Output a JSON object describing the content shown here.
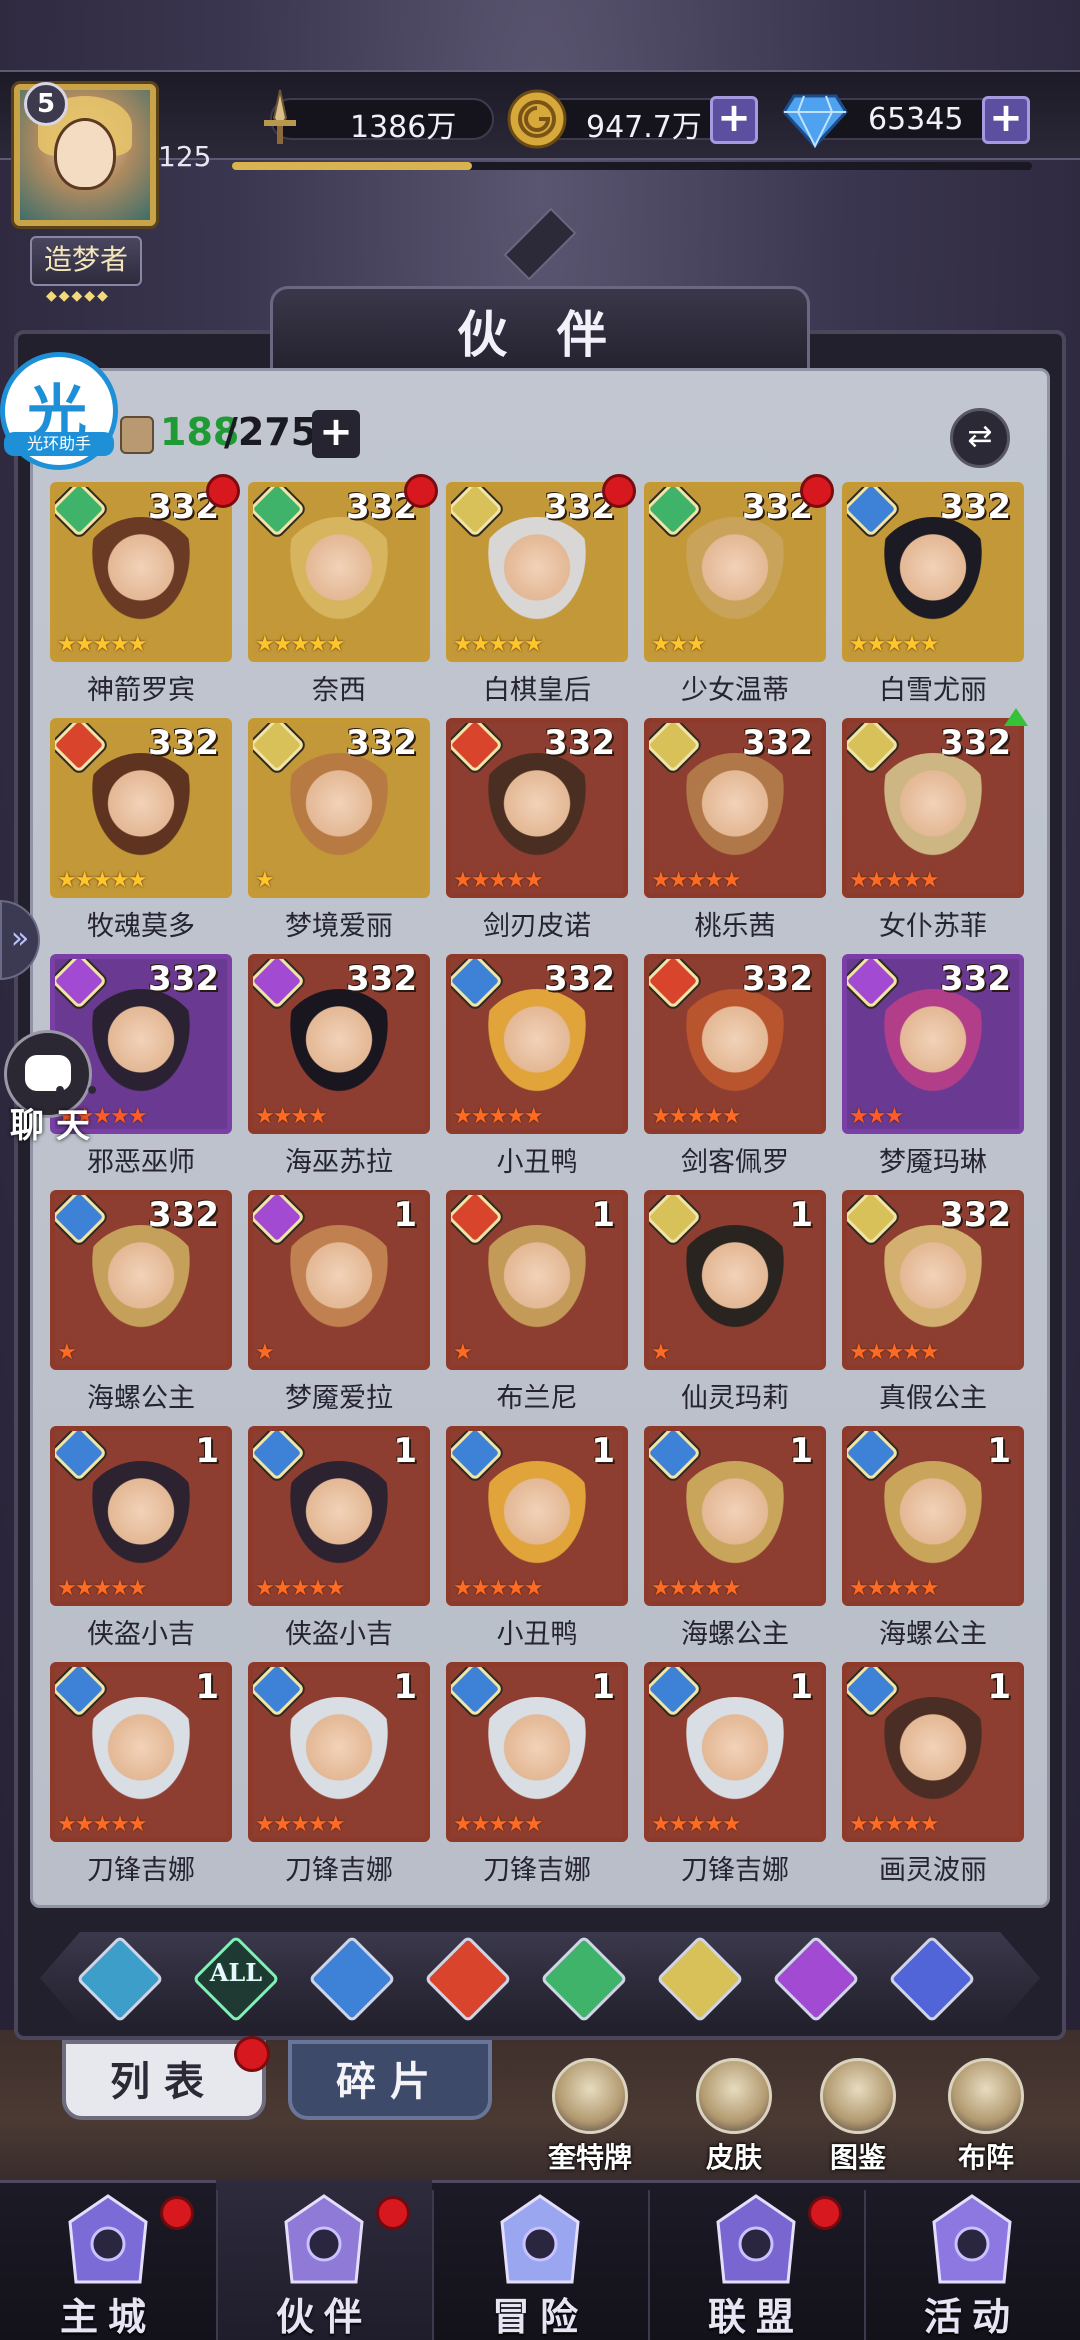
{
  "player": {
    "level": "5",
    "exp_value": "125",
    "title_badge": "造梦者",
    "exp_progress": 0.3
  },
  "resources": {
    "power": "1386万",
    "gold": "947.7万",
    "diamond": "65345"
  },
  "panel": {
    "title": "伙 伴"
  },
  "assistant": {
    "char": "光",
    "label": "光环助手"
  },
  "chat": {
    "label": "聊 天"
  },
  "roster": {
    "current": "188",
    "max": "/275"
  },
  "heroes": [
    {
      "name": "神箭罗宾",
      "level": "332",
      "element": "earth",
      "rarity": "gold",
      "stars": "★★★★★",
      "red_dot": true
    },
    {
      "name": "奈西",
      "level": "332",
      "element": "earth",
      "rarity": "gold",
      "stars": "★★★★★",
      "red_dot": true
    },
    {
      "name": "白棋皇后",
      "level": "332",
      "element": "light",
      "rarity": "gold",
      "stars": "★★★★★",
      "red_dot": true
    },
    {
      "name": "少女温蒂",
      "level": "332",
      "element": "earth",
      "rarity": "gold",
      "stars": "★★★",
      "red_dot": true
    },
    {
      "name": "白雪尤丽",
      "level": "332",
      "element": "water",
      "rarity": "gold",
      "stars": "★★★★★",
      "red_dot": false
    },
    {
      "name": "牧魂莫多",
      "level": "332",
      "element": "fire",
      "rarity": "gold",
      "stars": "★★★★★",
      "red_dot": false
    },
    {
      "name": "梦境爱丽",
      "level": "332",
      "element": "light",
      "rarity": "gold",
      "stars": "★",
      "red_dot": false
    },
    {
      "name": "剑刃皮诺",
      "level": "332",
      "element": "fire",
      "rarity": "red",
      "stars": "★★★★★",
      "red_dot": false
    },
    {
      "name": "桃乐茜",
      "level": "332",
      "element": "light",
      "rarity": "red",
      "stars": "★★★★★",
      "red_dot": false
    },
    {
      "name": "女仆苏菲",
      "level": "332",
      "element": "light",
      "rarity": "red",
      "stars": "★★★★★",
      "red_dot": false,
      "up": true
    },
    {
      "name": "邪恶巫师",
      "level": "332",
      "element": "dark",
      "rarity": "purple",
      "stars": "★★★★★",
      "red_dot": false
    },
    {
      "name": "海巫苏拉",
      "level": "332",
      "element": "dark",
      "rarity": "red",
      "stars": "★★★★",
      "red_dot": false
    },
    {
      "name": "小丑鸭",
      "level": "332",
      "element": "water",
      "rarity": "red",
      "stars": "★★★★★",
      "red_dot": false
    },
    {
      "name": "剑客佩罗",
      "level": "332",
      "element": "fire",
      "rarity": "red",
      "stars": "★★★★★",
      "red_dot": false
    },
    {
      "name": "梦魇玛琳",
      "level": "332",
      "element": "dark",
      "rarity": "purple",
      "stars": "★★★",
      "red_dot": false
    },
    {
      "name": "海螺公主",
      "level": "332",
      "element": "water",
      "rarity": "red",
      "stars": "★",
      "red_dot": false
    },
    {
      "name": "梦魇爱拉",
      "level": "1",
      "element": "dark",
      "rarity": "red",
      "stars": "★",
      "red_dot": false
    },
    {
      "name": "布兰尼",
      "level": "1",
      "element": "fire",
      "rarity": "red",
      "stars": "★",
      "red_dot": false
    },
    {
      "name": "仙灵玛莉",
      "level": "1",
      "element": "light",
      "rarity": "red",
      "stars": "★",
      "red_dot": false
    },
    {
      "name": "真假公主",
      "level": "332",
      "element": "light",
      "rarity": "red",
      "stars": "★★★★★",
      "red_dot": false
    },
    {
      "name": "侠盗小吉",
      "level": "1",
      "element": "water",
      "rarity": "red",
      "stars": "★★★★★",
      "red_dot": false
    },
    {
      "name": "侠盗小吉",
      "level": "1",
      "element": "water",
      "rarity": "red",
      "stars": "★★★★★",
      "red_dot": false
    },
    {
      "name": "小丑鸭",
      "level": "1",
      "element": "water",
      "rarity": "red",
      "stars": "★★★★★",
      "red_dot": false
    },
    {
      "name": "海螺公主",
      "level": "1",
      "element": "water",
      "rarity": "red",
      "stars": "★★★★★",
      "red_dot": false
    },
    {
      "name": "海螺公主",
      "level": "1",
      "element": "water",
      "rarity": "red",
      "stars": "★★★★★",
      "red_dot": false
    },
    {
      "name": "刀锋吉娜",
      "level": "1",
      "element": "water",
      "rarity": "red",
      "stars": "★★★★★",
      "red_dot": false
    },
    {
      "name": "刀锋吉娜",
      "level": "1",
      "element": "water",
      "rarity": "red",
      "stars": "★★★★★",
      "red_dot": false
    },
    {
      "name": "刀锋吉娜",
      "level": "1",
      "element": "water",
      "rarity": "red",
      "stars": "★★★★★",
      "red_dot": false
    },
    {
      "name": "刀锋吉娜",
      "level": "1",
      "element": "water",
      "rarity": "red",
      "stars": "★★★★★",
      "red_dot": false
    },
    {
      "name": "画灵波丽",
      "level": "1",
      "element": "water",
      "rarity": "red",
      "stars": "★★★★★",
      "red_dot": false
    }
  ],
  "filters": [
    {
      "id": "filter-none",
      "color": "#3d9fc9"
    },
    {
      "id": "filter-all",
      "label": "ALL",
      "color": "#3bb473"
    },
    {
      "id": "filter-water",
      "color": "#3d82d6"
    },
    {
      "id": "filter-fire",
      "color": "#d9452c"
    },
    {
      "id": "filter-earth",
      "color": "#3fb36a"
    },
    {
      "id": "filter-light",
      "color": "#d9c15a"
    },
    {
      "id": "filter-dark",
      "color": "#a24bd2"
    },
    {
      "id": "filter-cosmic",
      "color": "#5164d8"
    }
  ],
  "tabs": {
    "list": "列表",
    "fragments": "碎片"
  },
  "quick_actions": [
    {
      "label": "奎特牌"
    },
    {
      "label": "皮肤"
    },
    {
      "label": "图鉴"
    },
    {
      "label": "布阵"
    }
  ],
  "bottom_nav": [
    {
      "label": "主城",
      "red_dot": true
    },
    {
      "label": "伙伴",
      "red_dot": true,
      "active": true
    },
    {
      "label": "冒险",
      "red_dot": false
    },
    {
      "label": "联盟",
      "red_dot": true
    },
    {
      "label": "活动",
      "red_dot": false
    }
  ],
  "colors": {
    "accent_gold": "#c9a347",
    "count_green": "#1f9a35",
    "red_dot": "#d7181f"
  }
}
